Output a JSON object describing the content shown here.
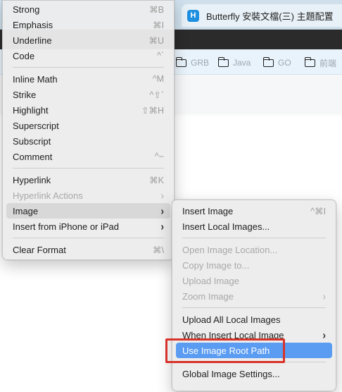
{
  "browser": {
    "tab_title": "Butterfly 安裝文檔(三) 主題配置",
    "tab_favicon_letter": "H",
    "bookmarks": [
      "GRB",
      "Java",
      "GO",
      "前端"
    ]
  },
  "main_menu": {
    "items": [
      {
        "label": "Strong",
        "shortcut": "⌘B"
      },
      {
        "label": "Emphasis",
        "shortcut": "⌘I"
      },
      {
        "label": "Underline",
        "shortcut": "⌘U"
      },
      {
        "label": "Code",
        "shortcut": "^`"
      },
      {
        "label": "Inline Math",
        "shortcut": "^M"
      },
      {
        "label": "Strike",
        "shortcut": "^⇧`"
      },
      {
        "label": "Highlight",
        "shortcut": "⇧⌘H"
      },
      {
        "label": "Superscript",
        "shortcut": ""
      },
      {
        "label": "Subscript",
        "shortcut": ""
      },
      {
        "label": "Comment",
        "shortcut": "^−"
      },
      {
        "label": "Hyperlink",
        "shortcut": "⌘K"
      },
      {
        "label": "Hyperlink Actions",
        "shortcut": "›"
      },
      {
        "label": "Image",
        "shortcut": "›"
      },
      {
        "label": "Insert from iPhone or iPad",
        "shortcut": "›"
      },
      {
        "label": "Clear Format",
        "shortcut": "⌘\\"
      }
    ]
  },
  "sub_menu": {
    "items": [
      {
        "label": "Insert Image",
        "shortcut": "^⌘I"
      },
      {
        "label": "Insert Local Images...",
        "shortcut": ""
      },
      {
        "label": "Open Image Location...",
        "shortcut": ""
      },
      {
        "label": "Copy Image to...",
        "shortcut": ""
      },
      {
        "label": "Upload Image",
        "shortcut": ""
      },
      {
        "label": "Zoom Image",
        "shortcut": "›"
      },
      {
        "label": "Upload All Local Images",
        "shortcut": ""
      },
      {
        "label": "When Insert Local Image",
        "shortcut": "›"
      },
      {
        "label": "Use Image Root Path",
        "shortcut": ""
      },
      {
        "label": "Global Image Settings...",
        "shortcut": ""
      }
    ]
  },
  "colors": {
    "selection": "#5a9cf2",
    "annotation_box": "#d8332a"
  }
}
